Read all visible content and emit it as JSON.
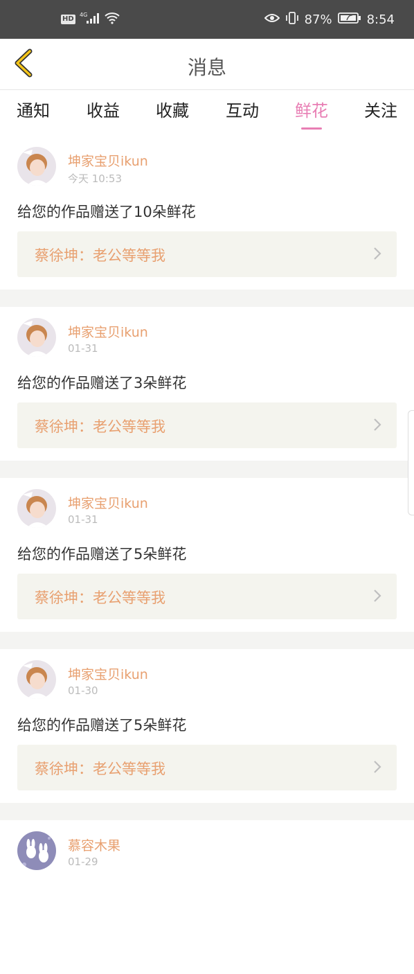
{
  "status_bar": {
    "hd": "HD",
    "network": "4G",
    "battery": "87%",
    "time": "8:54"
  },
  "header": {
    "title": "消息"
  },
  "tabs": [
    {
      "label": "通知"
    },
    {
      "label": "收益"
    },
    {
      "label": "收藏"
    },
    {
      "label": "互动"
    },
    {
      "label": "鲜花",
      "active": true
    },
    {
      "label": "关注"
    }
  ],
  "colors": {
    "accent": "#e87eb4",
    "name": "#e8a070",
    "quote_bg": "#f4f4ee"
  },
  "items": [
    {
      "user": "坤家宝贝ikun",
      "time": "今天 10:53",
      "message": "给您的作品赠送了10朵鲜花",
      "quote": "蔡徐坤：老公等等我"
    },
    {
      "user": "坤家宝贝ikun",
      "time": "01-31",
      "message": "给您的作品赠送了3朵鲜花",
      "quote": "蔡徐坤：老公等等我"
    },
    {
      "user": "坤家宝贝ikun",
      "time": "01-31",
      "message": "给您的作品赠送了5朵鲜花",
      "quote": "蔡徐坤：老公等等我"
    },
    {
      "user": "坤家宝贝ikun",
      "time": "01-30",
      "message": "给您的作品赠送了5朵鲜花",
      "quote": "蔡徐坤：老公等等我"
    },
    {
      "user": "慕容木果",
      "time": "01-29",
      "message": "",
      "quote": ""
    }
  ]
}
